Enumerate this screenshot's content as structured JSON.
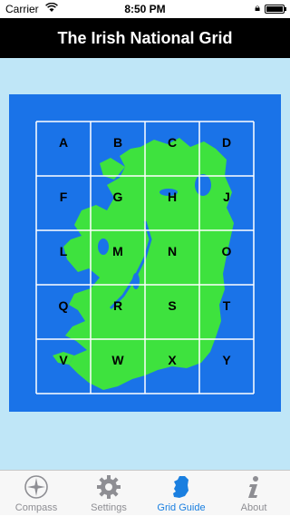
{
  "status": {
    "carrier": "Carrier",
    "time": "8:50 PM"
  },
  "navbar": {
    "title": "The Irish National Grid"
  },
  "grid": {
    "rows": [
      [
        "A",
        "B",
        "C",
        "D"
      ],
      [
        "F",
        "G",
        "H",
        "J"
      ],
      [
        "L",
        "M",
        "N",
        "O"
      ],
      [
        "Q",
        "R",
        "S",
        "T"
      ],
      [
        "V",
        "W",
        "X",
        "Y"
      ]
    ]
  },
  "colors": {
    "sea": "#1a73e8",
    "land": "#3ee23e",
    "gridline": "#ffffff",
    "background": "#bfe6f7",
    "tab_active": "#1a7fe0"
  },
  "tabs": [
    {
      "label": "Compass",
      "icon": "compass-icon"
    },
    {
      "label": "Settings",
      "icon": "gear-icon"
    },
    {
      "label": "Grid Guide",
      "icon": "ireland-map-icon",
      "active": true
    },
    {
      "label": "About",
      "icon": "info-icon"
    }
  ]
}
